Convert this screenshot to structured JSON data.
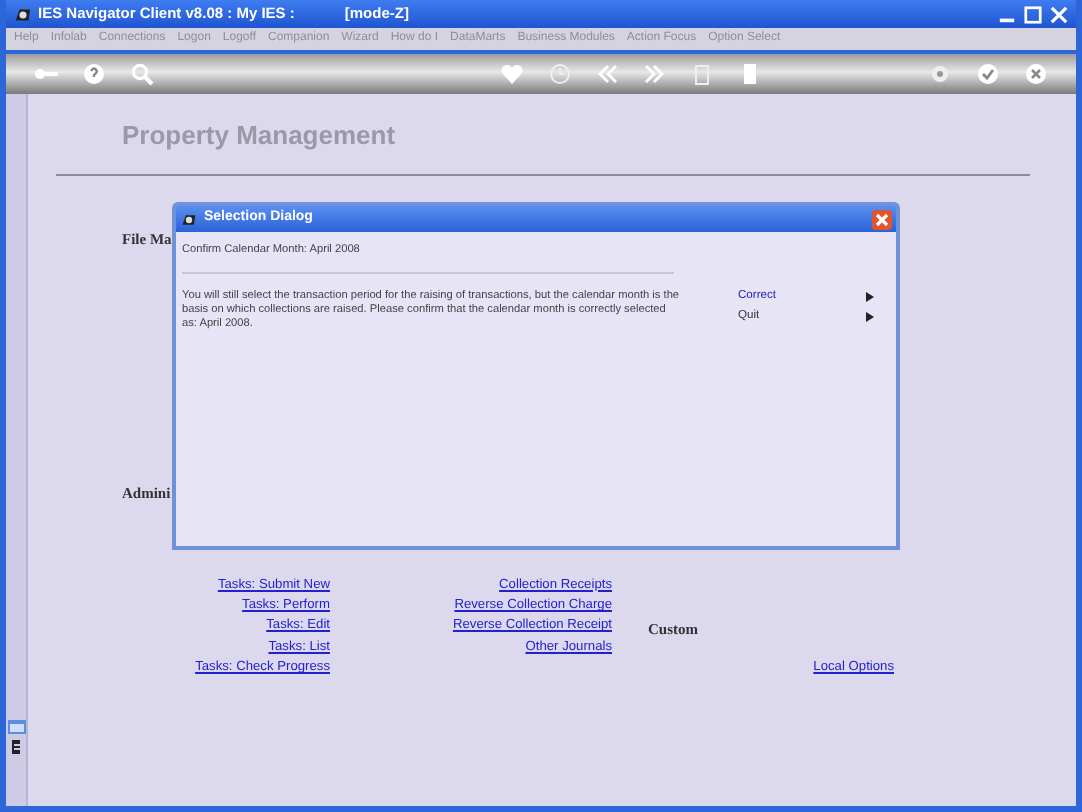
{
  "window": {
    "title": "IES Navigator Client v8.08 : My IES :",
    "mode": "[mode-Z]"
  },
  "menu": [
    "Help",
    "Infolab",
    "Connections",
    "Logon",
    "Logoff",
    "Companion",
    "Wizard",
    "How do I",
    "DataMarts",
    "Business Modules",
    "Action Focus",
    "Option Select"
  ],
  "page": {
    "title": "Property Management",
    "sections": [
      "File Ma",
      "Admini"
    ],
    "columns": [
      {
        "links": [
          "Tasks: Submit New",
          "Tasks: Perform",
          "Tasks: Edit",
          "Tasks: List",
          "Tasks: Check Progress"
        ]
      },
      {
        "links": [
          "Collection Receipts",
          "Reverse Collection Charge",
          "Reverse Collection Receipt",
          "Other Journals"
        ]
      },
      {
        "heading": "Custom"
      },
      {
        "links": [
          "Local Options"
        ]
      }
    ]
  },
  "dialog": {
    "title": "Selection Dialog",
    "prompt": "Confirm Calendar Month:  April 2008",
    "message": "You will still select the transaction period for the raising of transactions, but the calendar month is the basis on which collections are raised. Please confirm that the calendar month is correctly selected as: April 2008.",
    "options": [
      {
        "label": "Correct",
        "selected": true
      },
      {
        "label": "Quit",
        "selected": false
      }
    ]
  }
}
